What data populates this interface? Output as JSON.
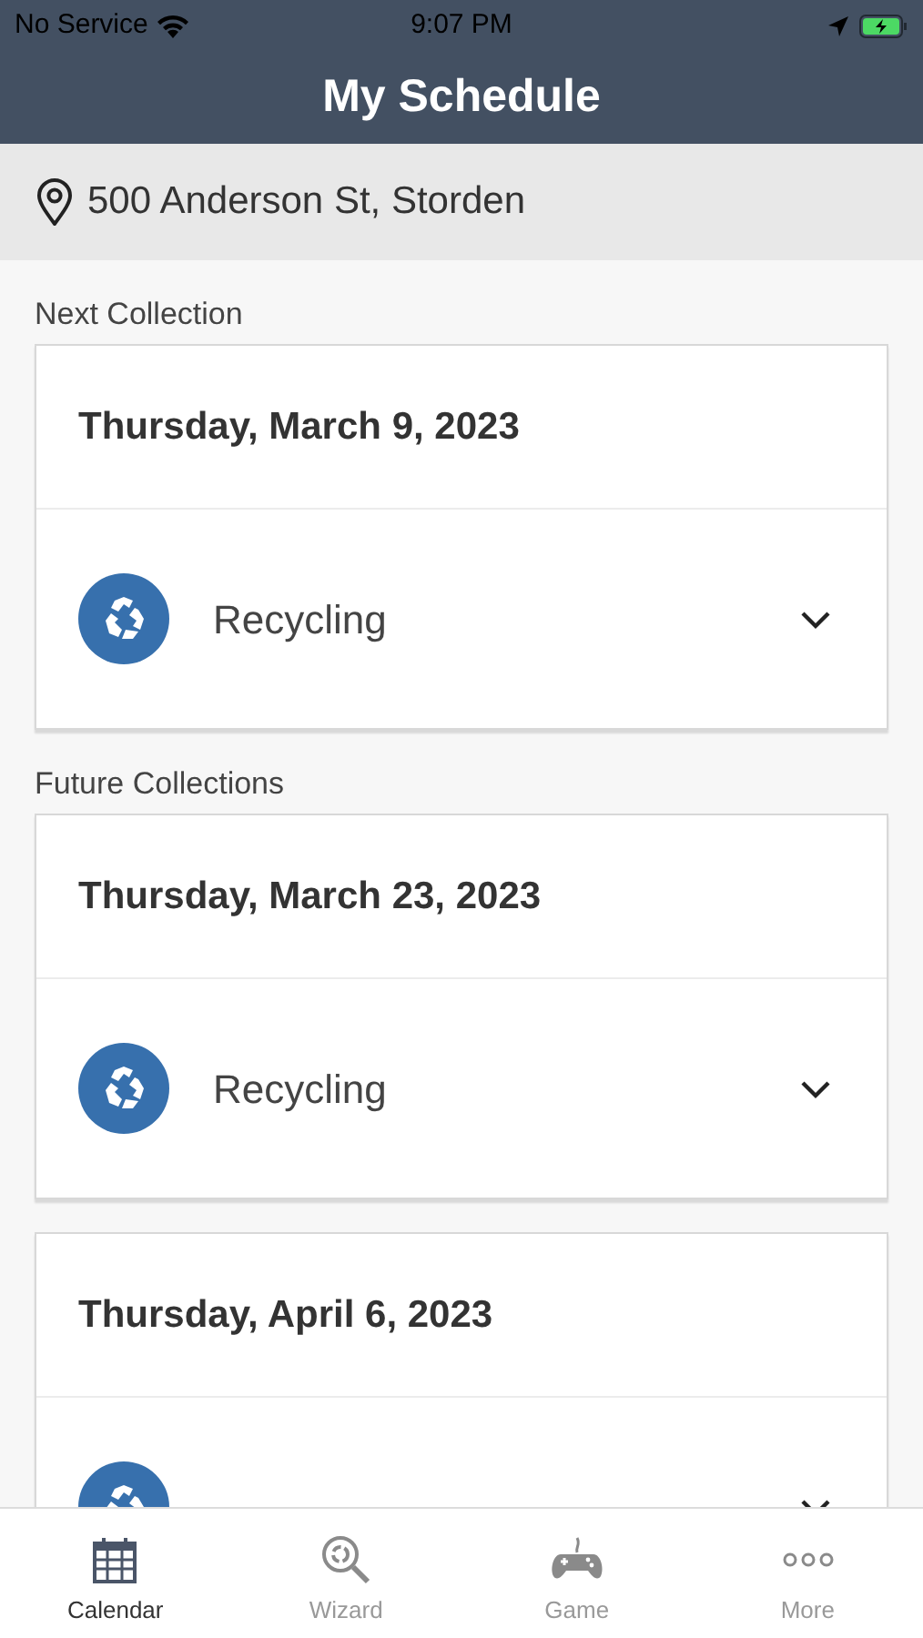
{
  "status_bar": {
    "carrier": "No Service",
    "time": "9:07 PM"
  },
  "header": {
    "title": "My Schedule"
  },
  "address": "500 Anderson St, Storden",
  "sections": [
    {
      "label": "Next Collection",
      "collections": [
        {
          "date": "Thursday, March 9, 2023",
          "service": "Recycling",
          "expanded": false
        }
      ]
    },
    {
      "label": "Future Collections",
      "collections": [
        {
          "date": "Thursday, March 23, 2023",
          "service": "Recycling",
          "expanded": false
        },
        {
          "date": "Thursday, April 6, 2023",
          "expanded": false
        }
      ]
    }
  ],
  "tabs": [
    {
      "label": "Calendar",
      "kind": "calendar",
      "selected": true
    },
    {
      "label": "Wizard",
      "kind": "wizard",
      "selected": false
    },
    {
      "label": "Game",
      "kind": "game",
      "selected": false
    },
    {
      "label": "More",
      "kind": "more",
      "selected": false
    }
  ]
}
